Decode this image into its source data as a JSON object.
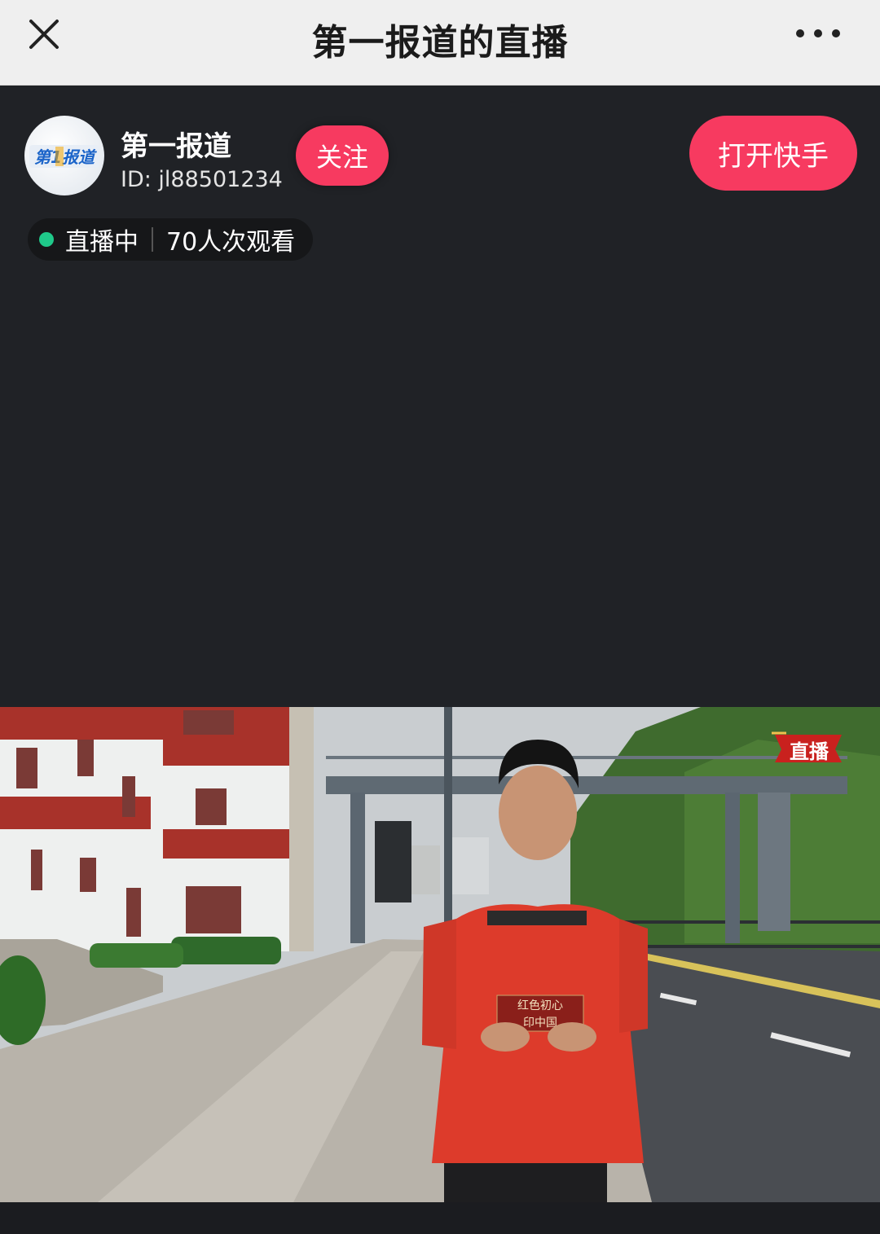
{
  "nav": {
    "title": "第一报道的直播",
    "close_icon": "close-icon",
    "more_icon": "more-icon"
  },
  "streamer": {
    "name": "第一报道",
    "id": "ID:  jl88501234",
    "follow_label": "关注",
    "avatar_logo_text": "第1报道"
  },
  "open_app_label": "打开快手",
  "live": {
    "status": "直播中",
    "viewers": "70人次观看"
  },
  "video": {
    "live_badge": "直播",
    "card_text_1": "红色初心",
    "card_text_2": "印中国"
  },
  "colors": {
    "accent": "#f73a60",
    "live_dot": "#1fc98a",
    "bg": "#202226"
  }
}
